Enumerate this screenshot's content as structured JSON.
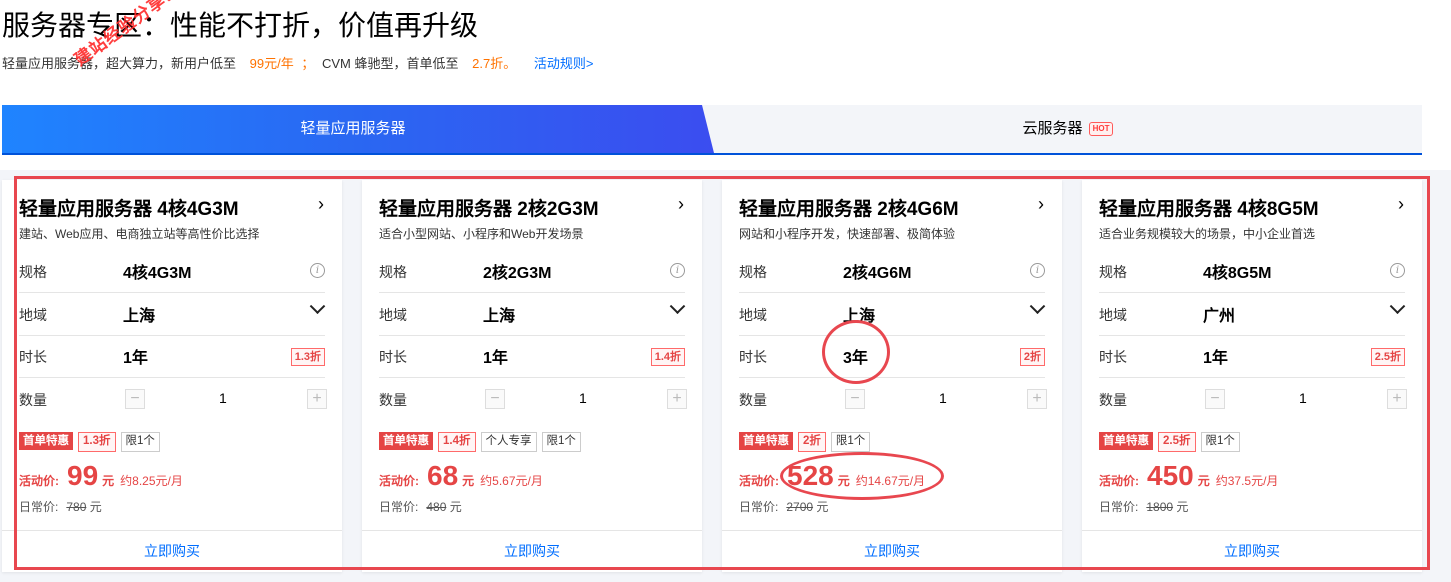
{
  "page": {
    "title": "服务器专区：性能不打折，价值再升级",
    "subtitle_a": "轻量应用服务器，超大算力，新用户低至",
    "subtitle_price1": "99元/年",
    "subtitle_sep": "；",
    "subtitle_b": "CVM 蜂驰型，首单低至",
    "subtitle_price2": "2.7折。",
    "rules_link": "活动规则>",
    "watermark": "建站经验分享www.w"
  },
  "tabs": [
    {
      "label": "轻量应用服务器",
      "active": true
    },
    {
      "label": "云服务器",
      "badge": "HOT",
      "active": false
    }
  ],
  "labels": {
    "spec": "规格",
    "region": "地域",
    "duration": "时长",
    "quantity": "数量",
    "activity_price": "活动价:",
    "regular_price": "日常价:",
    "buy": "立即购买",
    "arrow": "›",
    "info": "i",
    "minus": "−",
    "plus": "+",
    "yuan": "元"
  },
  "cards": [
    {
      "title": "轻量应用服务器 4核4G3M",
      "desc": "建站、Web应用、电商独立站等高性价比选择",
      "spec": "4核4G3M",
      "region": "上海",
      "duration": "1年",
      "duration_discount": "1.3折",
      "quantity": "1",
      "tag_first": "首单特惠",
      "tag_discount": "1.3折",
      "tag_extra": "",
      "tag_limit": "限1个",
      "price": "99",
      "price_unit": "元",
      "monthly": "约8.25元/月",
      "original": "780",
      "original_unit": "元"
    },
    {
      "title": "轻量应用服务器 2核2G3M",
      "desc": "适合小型网站、小程序和Web开发场景",
      "spec": "2核2G3M",
      "region": "上海",
      "duration": "1年",
      "duration_discount": "1.4折",
      "quantity": "1",
      "tag_first": "首单特惠",
      "tag_discount": "1.4折",
      "tag_extra": "个人专享",
      "tag_limit": "限1个",
      "price": "68",
      "price_unit": "元",
      "monthly": "约5.67元/月",
      "original": "480",
      "original_unit": "元"
    },
    {
      "title": "轻量应用服务器 2核4G6M",
      "desc": "网站和小程序开发，快速部署、极简体验",
      "spec": "2核4G6M",
      "region": "上海",
      "duration": "3年",
      "duration_discount": "2折",
      "quantity": "1",
      "tag_first": "首单特惠",
      "tag_discount": "2折",
      "tag_extra": "",
      "tag_limit": "限1个",
      "price": "528",
      "price_unit": "元",
      "monthly": "约14.67元/月",
      "original": "2700",
      "original_unit": "元"
    },
    {
      "title": "轻量应用服务器 4核8G5M",
      "desc": "适合业务规模较大的场景，中小企业首选",
      "spec": "4核8G5M",
      "region": "广州",
      "duration": "1年",
      "duration_discount": "2.5折",
      "quantity": "1",
      "tag_first": "首单特惠",
      "tag_discount": "2.5折",
      "tag_extra": "",
      "tag_limit": "限1个",
      "price": "450",
      "price_unit": "元",
      "monthly": "约37.5元/月",
      "original": "1800",
      "original_unit": "元"
    }
  ],
  "colors": {
    "accent": "#006eff",
    "price_red": "#e54545",
    "highlight_orange": "#ff7200",
    "annotation_red": "#e8474f"
  }
}
